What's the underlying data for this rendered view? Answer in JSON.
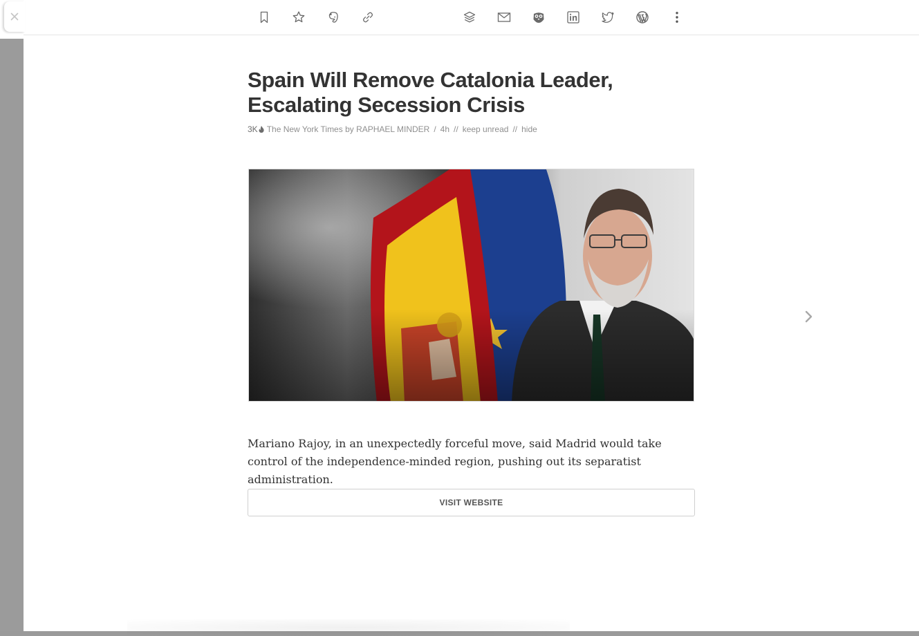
{
  "toolbar": {
    "left_icons": [
      "bookmark-icon",
      "star-icon",
      "evernote-icon",
      "link-icon"
    ],
    "right_icons": [
      "stack-icon",
      "email-icon",
      "hootsuite-icon",
      "linkedin-icon",
      "twitter-icon",
      "wordpress-icon",
      "more-icon"
    ]
  },
  "article": {
    "title": "Spain Will Remove Catalonia Leader, Escalating Secession Crisis",
    "engagement": "3K",
    "source": "The New York Times by RAPHAEL MINDER",
    "separator_slash": "/",
    "age": "4h",
    "separator_double": "//",
    "keep_unread": "keep unread",
    "hide": "hide",
    "summary": "Mariano Rajoy, in an unexpectedly forceful move, said Madrid would take control of the independence-minded region, pushing out its separatist administration.",
    "visit_label": "VISIT WEBSITE"
  },
  "colors": {
    "title": "#333333",
    "meta": "#8f8f8f",
    "icon": "#6a6a6a",
    "backdrop": "#9b9b9b"
  }
}
